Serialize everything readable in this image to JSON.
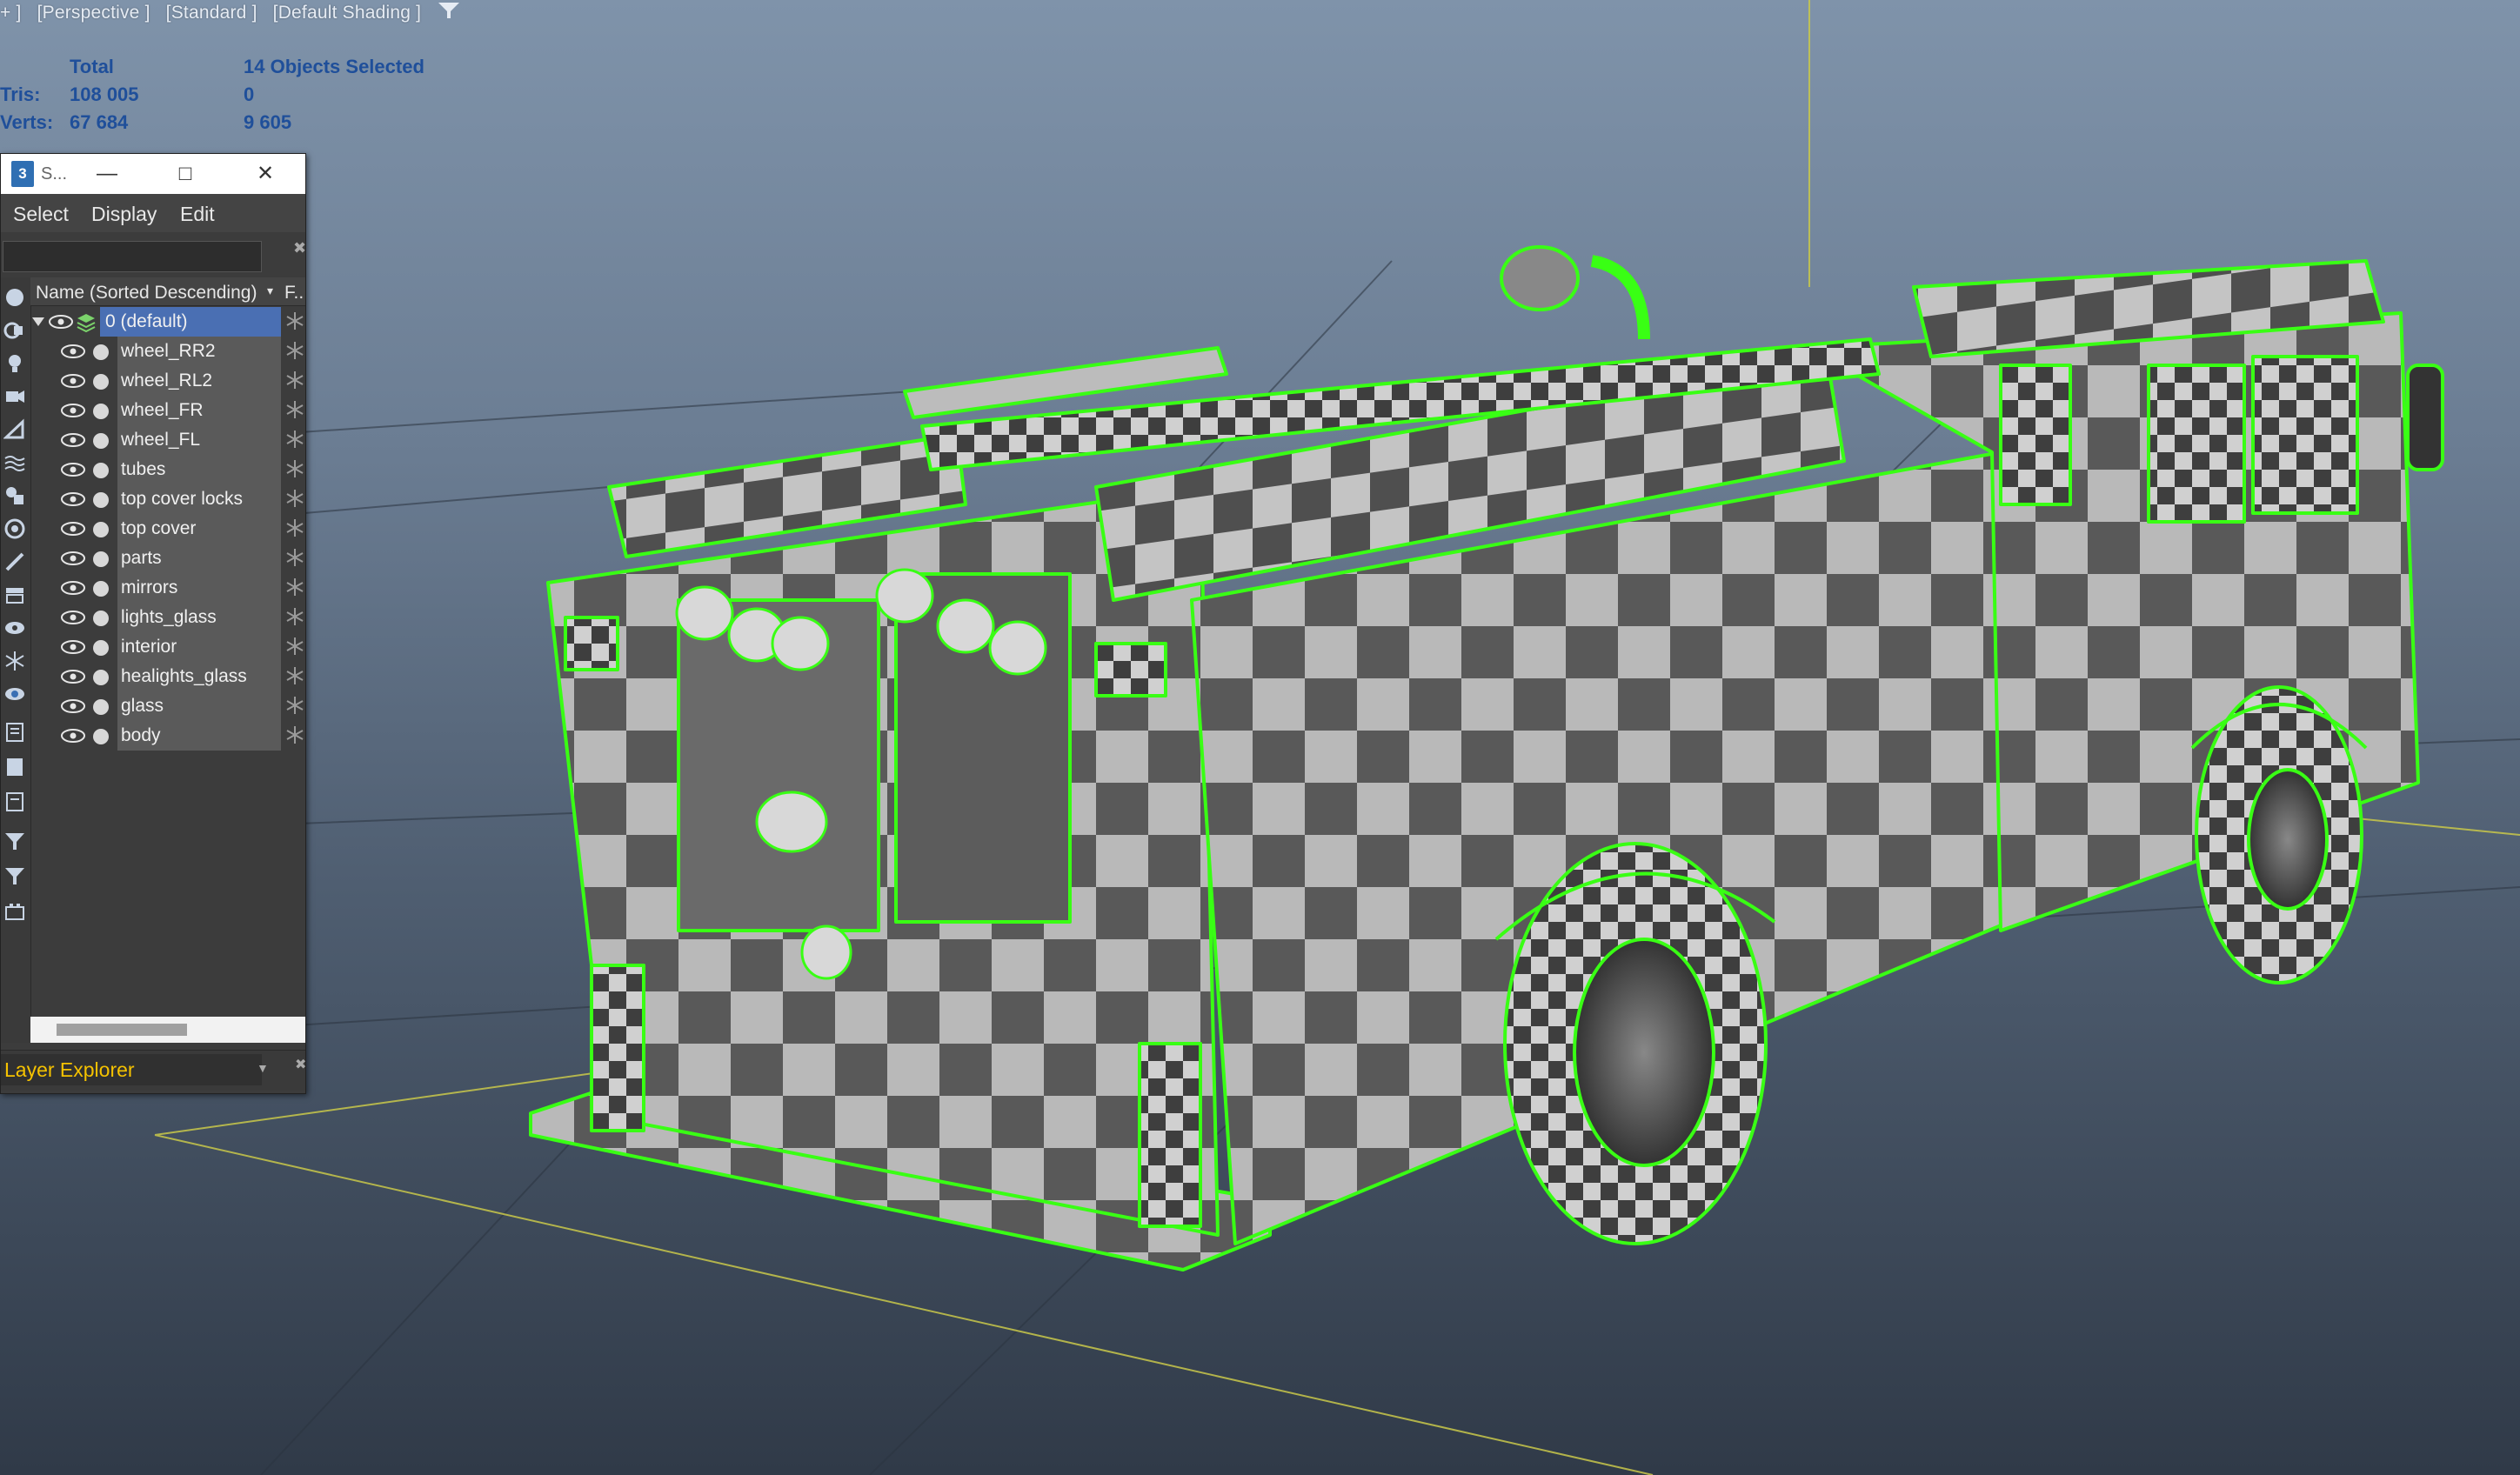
{
  "viewport": {
    "labels": [
      "+ ]",
      "[Perspective ]",
      "[Standard ]",
      "[Default Shading ]"
    ],
    "filter_icon": "funnel-icon"
  },
  "stats": {
    "header_total": "Total",
    "header_selected": "14 Objects Selected",
    "tris_label": "Tris:",
    "tris_total": "108 005",
    "tris_selected": "0",
    "verts_label": "Verts:",
    "verts_total": "67 684",
    "verts_selected": "9 605"
  },
  "panel": {
    "title": "S...",
    "app_icon": "3",
    "menu": [
      "Select",
      "Display",
      "Edit"
    ],
    "column_header": "Name (Sorted Descending)",
    "column_sort": "▾",
    "column_f": "F..",
    "layer": "0 (default)",
    "items": [
      "wheel_RR2",
      "wheel_RL2",
      "wheel_FR",
      "wheel_FL",
      "tubes",
      "top cover locks",
      "top cover",
      "parts",
      "mirrors",
      "lights_glass",
      "interior",
      "healights_glass",
      "glass",
      "body"
    ],
    "explorer_mode": "Layer Explorer"
  },
  "colors": {
    "selection_wire": "#39ff14",
    "stats_text": "#1f4f9a",
    "layer_highlight": "#4a6fb3",
    "explorer_mode_text": "#f5c200"
  }
}
